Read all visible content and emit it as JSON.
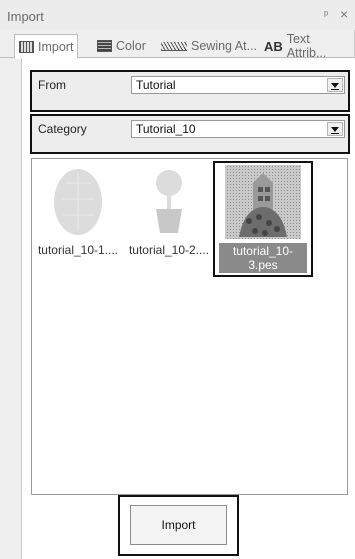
{
  "window": {
    "title": "Import",
    "pin_glyph": "ᴨ",
    "close_glyph": "×"
  },
  "tabs": [
    {
      "label": "Import",
      "icon": "import-icon",
      "active": true
    },
    {
      "label": "Color",
      "icon": "color-icon",
      "active": false
    },
    {
      "label": "Sewing At...",
      "icon": "sewing-icon",
      "active": false
    },
    {
      "label": "Text Attrib...",
      "icon": "text-ab-icon",
      "active": false,
      "icon_text": "AB"
    }
  ],
  "from": {
    "label": "From",
    "value": "Tutorial"
  },
  "category": {
    "label": "Category",
    "value": "Tutorial_10"
  },
  "thumbnails": [
    {
      "label": "tutorial_10-1....",
      "selected": false
    },
    {
      "label": "tutorial_10-2....",
      "selected": false
    },
    {
      "label": "tutorial_10-3.pes",
      "selected": true
    }
  ],
  "import_button": {
    "label": "Import"
  },
  "colors": {
    "selection_label_bg": "#8a8a8a",
    "highlight_border": "#111111"
  }
}
